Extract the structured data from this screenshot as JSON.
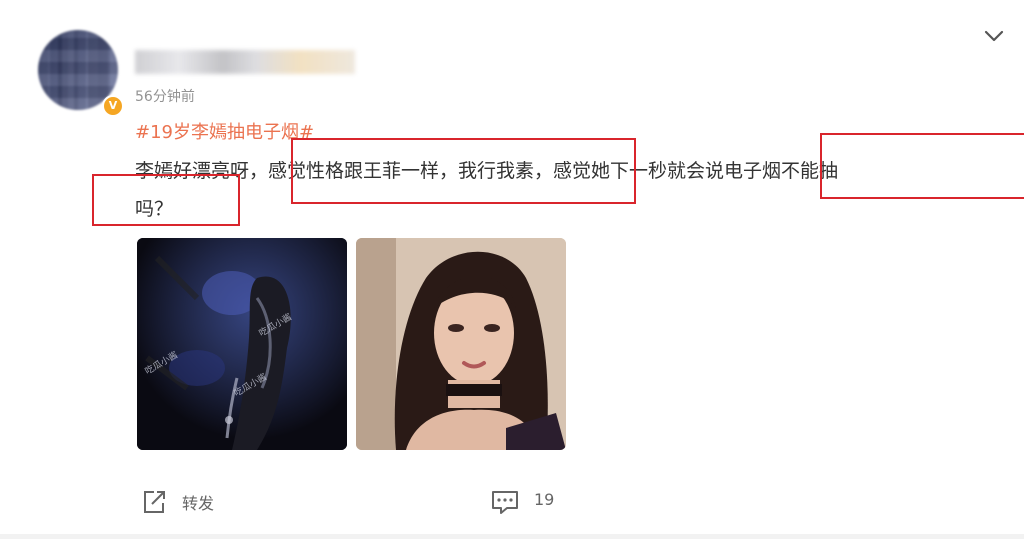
{
  "post": {
    "username": "",
    "time": "56分钟前",
    "hashtag": "#19岁李嫣抽电子烟#",
    "text_line1": "李嫣好漂亮呀，感觉性格跟王菲一样，我行我素，感觉她下一秒就会说电子烟不能抽",
    "text_line2": "吗？",
    "verified_badge": "V"
  },
  "images": [
    {
      "name": "night-photo",
      "watermark_lines": [
        "吃瓜小酱",
        "吃瓜小酱",
        "吃瓜小酱"
      ]
    },
    {
      "name": "portrait-photo"
    }
  ],
  "actions": {
    "repost_label": "转发",
    "comment_count": "19"
  },
  "colors": {
    "hashtag": "#eb7350",
    "highlight_box": "#d9252c",
    "badge": "#f5a623"
  },
  "icons": [
    "chevron-down-icon",
    "share-icon",
    "comment-icon"
  ]
}
